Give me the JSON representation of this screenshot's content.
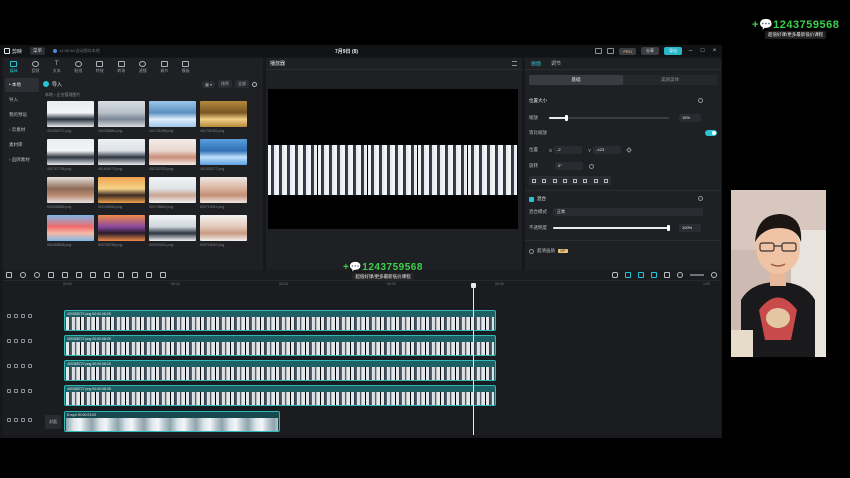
{
  "watermark": {
    "id_text": "1243759568",
    "caption": "超值好课/更多最新低价课程"
  },
  "titlebar": {
    "app_name": "剪映",
    "menu_label": "菜单",
    "autosave": "14:55:38 自动保存本地",
    "project_title": "7月9日 (8)",
    "pro_label": "PRO",
    "share_label": "分享",
    "export_label": "导出",
    "win_min": "–",
    "win_max": "□",
    "win_close": "×"
  },
  "media": {
    "tabs": [
      {
        "label": "媒体",
        "icon": "media-icon"
      },
      {
        "label": "音频",
        "icon": "audio-icon"
      },
      {
        "label": "文本",
        "icon": "text-icon"
      },
      {
        "label": "贴纸",
        "icon": "sticker-icon"
      },
      {
        "label": "特效",
        "icon": "effect-icon"
      },
      {
        "label": "转场",
        "icon": "transition-icon"
      },
      {
        "label": "滤镜",
        "icon": "filter-icon"
      },
      {
        "label": "调节",
        "icon": "adjust-icon"
      },
      {
        "label": "模板",
        "icon": "template-icon"
      }
    ],
    "side_items": [
      "• 本地",
      "导入",
      "我的预设",
      "› 云素材",
      "素材库",
      "› 品牌素材"
    ],
    "import_label": "导入",
    "sort_label": "排序",
    "filter_label": "全部",
    "breadcrumb": "本地 › 企业管理图片",
    "thumbs": [
      {
        "name": "400358727.png",
        "tone": "group"
      },
      {
        "name": "400358884.png",
        "tone": "meeting"
      },
      {
        "name": "401731058.png",
        "tone": "handshake"
      },
      {
        "name": "401731252.png",
        "tone": "gold"
      },
      {
        "name": "401767758.png",
        "tone": "group"
      },
      {
        "name": "401849175.png",
        "tone": "group2"
      },
      {
        "name": "401332333.png",
        "tone": "hands"
      },
      {
        "name": "401302277.png",
        "tone": "puzzle"
      },
      {
        "name": "500436868.png",
        "tone": "stack"
      },
      {
        "name": "500445660.png",
        "tone": "sunset"
      },
      {
        "name": "500708652.png",
        "tone": "handsup"
      },
      {
        "name": "500711081.png",
        "tone": "pile"
      },
      {
        "name": "500468888.png",
        "tone": "crowd"
      },
      {
        "name": "500785768.png",
        "tone": "silhouette"
      },
      {
        "name": "500933321.png",
        "tone": "team"
      },
      {
        "name": "500718397.png",
        "tone": "fist"
      }
    ]
  },
  "player": {
    "title": "播放器",
    "current_time": "00:00:07:26",
    "total_time": "00:00:08:25"
  },
  "inspector": {
    "tabs": [
      "画面",
      "调节"
    ],
    "subtabs": [
      "基础",
      "美颜美体"
    ],
    "position_size": "位置大小",
    "scale_label": "缩放",
    "scale_value": "15%",
    "uniform_scale": "等比缩放",
    "position_label": "位置",
    "x_value": "-2",
    "y_value": "-423",
    "rotate_label": "旋转",
    "rotate_value": "0°",
    "blend_label": "混合",
    "blend_mode_label": "混合模式",
    "blend_mode_value": "正常",
    "opacity_label": "不透明度",
    "opacity_value": "100%",
    "smart_enhance": "超清画质",
    "vip_badge": "VIP",
    "scale_fraction": 0.15,
    "opacity_fraction": 1.0
  },
  "timeline": {
    "ruler": [
      "00:00",
      "00:10",
      "00:20",
      "00:30",
      "00:40",
      "1:00"
    ],
    "tracks": [
      {
        "clip_label": "400358727.png  00:00:08:25"
      },
      {
        "clip_label": "400358727.png  00:00:08:25"
      },
      {
        "clip_label": "400358727.png  00:00:08:25"
      },
      {
        "clip_label": "400358727.png  00:00:08:25"
      }
    ],
    "audio_clip_label": "8.mp4  00:00:23:00",
    "cover_label": "封面"
  },
  "colors": {
    "accent": "#29c3d6",
    "clip": "#1e5f63",
    "watermark_green": "#3bd14c"
  }
}
